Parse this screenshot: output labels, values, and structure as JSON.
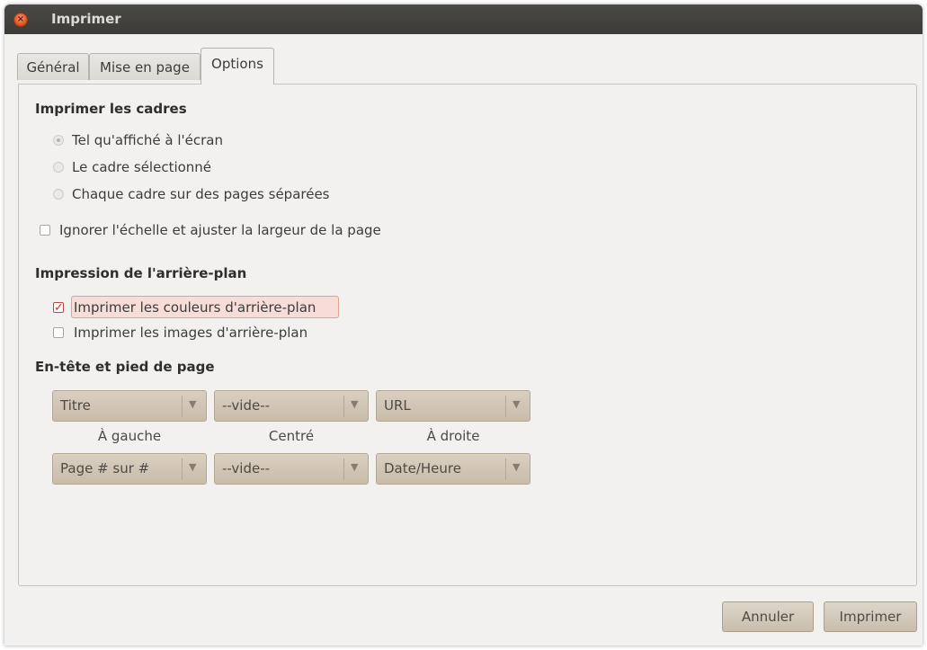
{
  "window": {
    "title": "Imprimer",
    "close_symbol": "×"
  },
  "tabs": [
    {
      "label": "Général"
    },
    {
      "label": "Mise en page"
    },
    {
      "label": "Options"
    }
  ],
  "frames": {
    "title": "Imprimer les cadres",
    "options": [
      {
        "label": "Tel qu'affiché à l'écran",
        "selected": true
      },
      {
        "label": "Le cadre sélectionné",
        "selected": false
      },
      {
        "label": "Chaque cadre sur des pages séparées",
        "selected": false
      }
    ],
    "ignore_scale": {
      "label": "Ignorer l'échelle et ajuster la largeur de la page",
      "checked": false
    }
  },
  "background": {
    "title": "Impression de l'arrière-plan",
    "print_colors": {
      "label": "Imprimer les couleurs d'arrière-plan",
      "checked": true
    },
    "print_images": {
      "label": "Imprimer les images d'arrière-plan",
      "checked": false
    }
  },
  "header_footer": {
    "title": "En-tête et pied de page",
    "header": {
      "left": "Titre",
      "center": "--vide--",
      "right": "URL"
    },
    "labels": {
      "left": "À gauche",
      "center": "Centré",
      "right": "À droite"
    },
    "footer": {
      "left": "Page # sur #",
      "center": "--vide--",
      "right": "Date/Heure"
    },
    "arrow_symbol": "▼"
  },
  "buttons": {
    "cancel": "Annuler",
    "print": "Imprimer"
  },
  "colors": {
    "accent": "#df4a16",
    "titlebar": "#3c3b37",
    "check": "#c9362c"
  }
}
